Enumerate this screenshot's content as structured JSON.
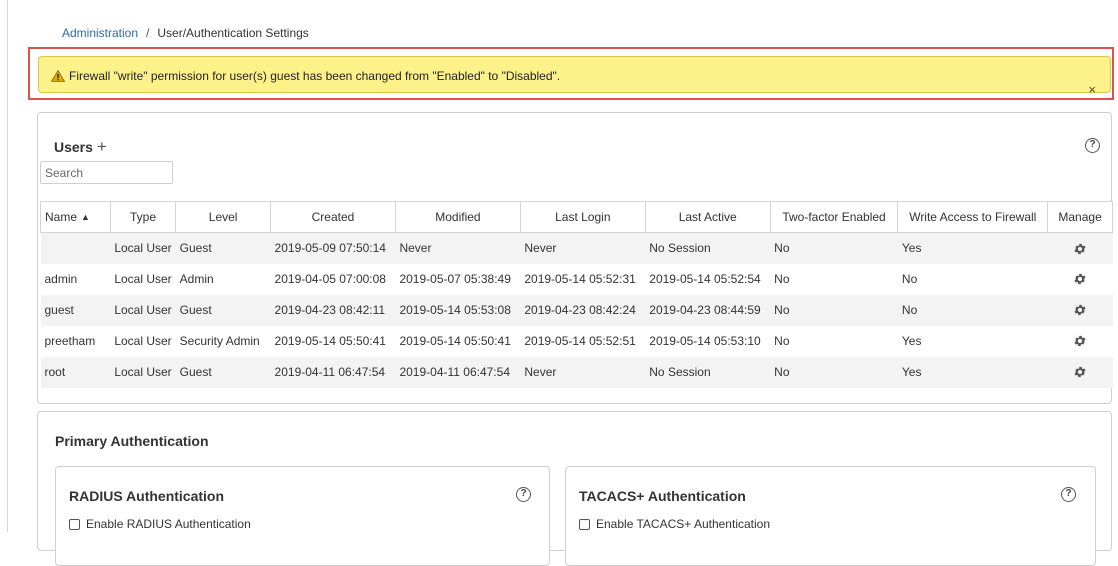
{
  "breadcrumb": {
    "parent": "Administration",
    "separator": "/",
    "current": "User/Authentication Settings"
  },
  "alert": {
    "icon": "warning-icon",
    "message": "Firewall \"write\" permission for user(s) guest has been changed from \"Enabled\" to \"Disabled\".",
    "close": "×",
    "background_color": "#fdf28a",
    "highlight_color": "#d9534f"
  },
  "users": {
    "title": "Users",
    "add_symbol": "+",
    "help_symbol": "?",
    "search_placeholder": "Search",
    "columns": [
      "Name",
      "Type",
      "Level",
      "Created",
      "Modified",
      "Last Login",
      "Last Active",
      "Two-factor Enabled",
      "Write Access to Firewall",
      "Manage"
    ],
    "sort_indicator": "▲",
    "rows": [
      [
        "",
        "Local User",
        "Guest",
        "2019-05-09 07:50:14",
        "Never",
        "Never",
        "No Session",
        "No",
        "Yes"
      ],
      [
        "admin",
        "Local User",
        "Admin",
        "2019-04-05 07:00:08",
        "2019-05-07 05:38:49",
        "2019-05-14 05:52:31",
        "2019-05-14 05:52:54",
        "No",
        "No"
      ],
      [
        "guest",
        "Local User",
        "Guest",
        "2019-04-23 08:42:11",
        "2019-05-14 05:53:08",
        "2019-04-23 08:42:24",
        "2019-04-23 08:44:59",
        "No",
        "No"
      ],
      [
        "preetham",
        "Local User",
        "Security Admin",
        "2019-05-14 05:50:41",
        "2019-05-14 05:50:41",
        "2019-05-14 05:52:51",
        "2019-05-14 05:53:10",
        "No",
        "Yes"
      ],
      [
        "root",
        "Local User",
        "Guest",
        "2019-04-11 06:47:54",
        "2019-04-11 06:47:54",
        "Never",
        "No Session",
        "No",
        "Yes"
      ]
    ],
    "manage_icon": "gear-icon"
  },
  "primary_auth": {
    "title": "Primary Authentication",
    "radius": {
      "title": "RADIUS Authentication",
      "checkbox_label": "Enable RADIUS Authentication",
      "checked": false
    },
    "tacacs": {
      "title": "TACACS+ Authentication",
      "checkbox_label": "Enable TACACS+ Authentication",
      "checked": false
    }
  },
  "colors": {
    "link": "#2b6cb0",
    "striped_row": "#f3f3f3",
    "border": "#cfcfcf"
  }
}
